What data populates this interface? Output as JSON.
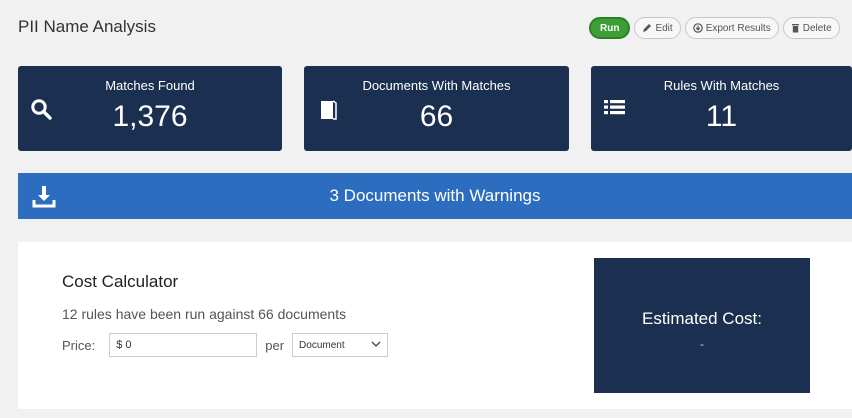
{
  "page": {
    "title": "PII Name Analysis"
  },
  "toolbar": {
    "run_label": "Run",
    "edit_label": "Edit",
    "export_label": "Export Results",
    "delete_label": "Delete"
  },
  "stats": [
    {
      "label": "Matches Found",
      "value": "1,376",
      "icon": "search-icon"
    },
    {
      "label": "Documents With Matches",
      "value": "66",
      "icon": "document-icon"
    },
    {
      "label": "Rules With Matches",
      "value": "11",
      "icon": "list-icon"
    }
  ],
  "warning": {
    "text": "3 Documents with Warnings",
    "icon": "download-icon"
  },
  "calculator": {
    "title": "Cost Calculator",
    "description": "12 rules have been run against 66 documents",
    "price_label": "Price:",
    "price_value": "$ 0",
    "per_label": "per",
    "unit_value": "Document",
    "estimated_label": "Estimated Cost:",
    "estimated_value": "-"
  },
  "colors": {
    "navy": "#1b3050",
    "blue": "#2c6dbf",
    "green": "#3d9e35"
  }
}
